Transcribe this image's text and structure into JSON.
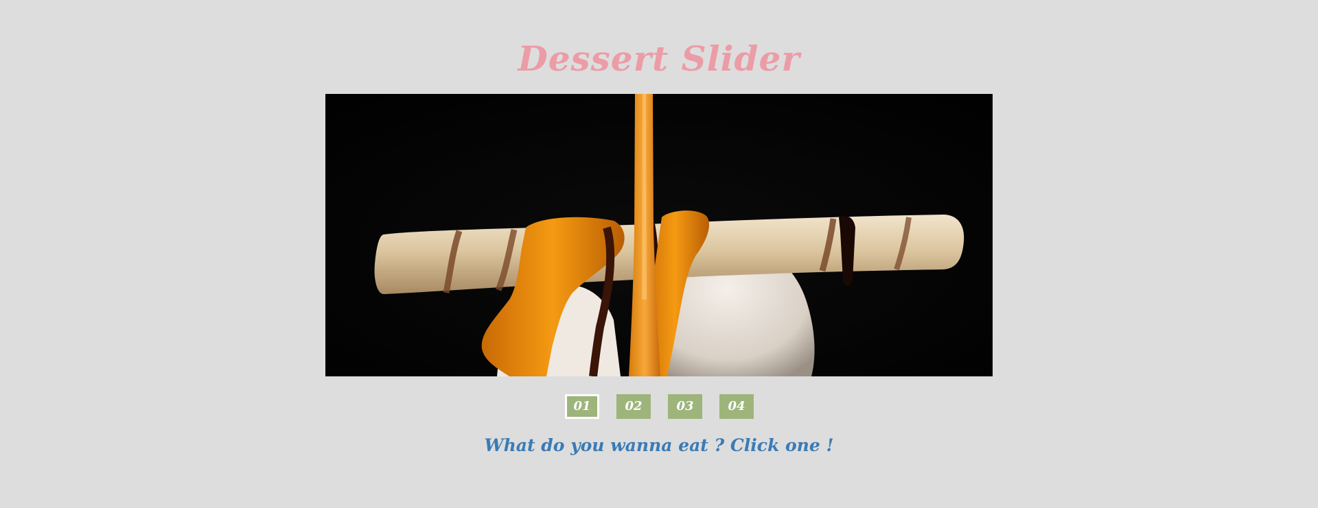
{
  "header": {
    "title": "Dessert Slider"
  },
  "slider": {
    "current_slide": 1,
    "image": {
      "subject": "wafer roll on ice cream drizzled with caramel and chocolate sauce"
    },
    "pager": [
      {
        "label": "01",
        "active": true
      },
      {
        "label": "02",
        "active": false
      },
      {
        "label": "03",
        "active": false
      },
      {
        "label": "04",
        "active": false
      }
    ]
  },
  "caption": {
    "text": "What do you wanna eat ? Click one !"
  },
  "colors": {
    "background": "#dddddd",
    "title": "#ec9ca6",
    "pager_button": "#9db47b",
    "pager_active_border": "#ffffff",
    "caption": "#3a7bb5"
  }
}
